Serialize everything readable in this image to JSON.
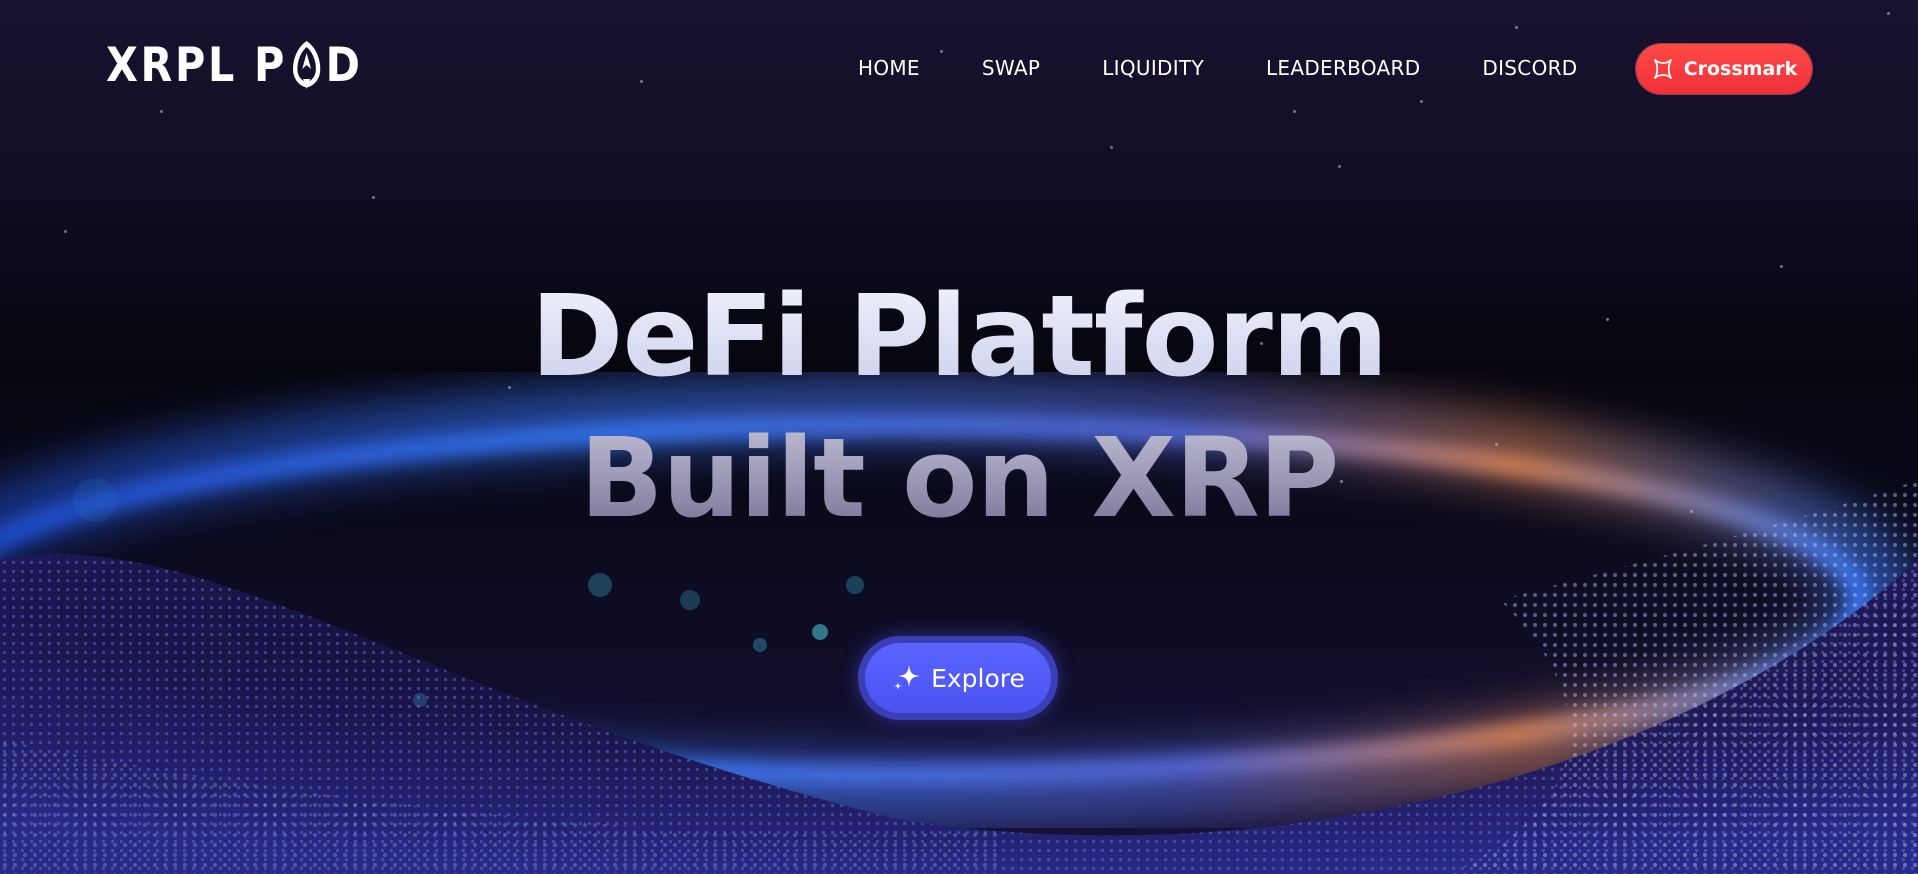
{
  "brand": {
    "logo_left": "XRPL P",
    "logo_right": "D",
    "logo_icon": "rocket-icon"
  },
  "nav": {
    "items": [
      {
        "label": "HOME"
      },
      {
        "label": "SWAP"
      },
      {
        "label": "LIQUIDITY"
      },
      {
        "label": "LEADERBOARD"
      },
      {
        "label": "DISCORD"
      }
    ]
  },
  "wallet": {
    "label": "Crossmark",
    "icon": "crossmark-icon",
    "color": "#f23a3e"
  },
  "hero": {
    "line1": "DeFi Platform",
    "line2": "Built on XRP",
    "cta_label": "Explore",
    "cta_icon": "sparkle-icon",
    "cta_color": "#5157f5"
  },
  "colors": {
    "background": "#0c0818",
    "wave_blue": "#2f6bff",
    "wave_orange": "#e08a5a"
  }
}
